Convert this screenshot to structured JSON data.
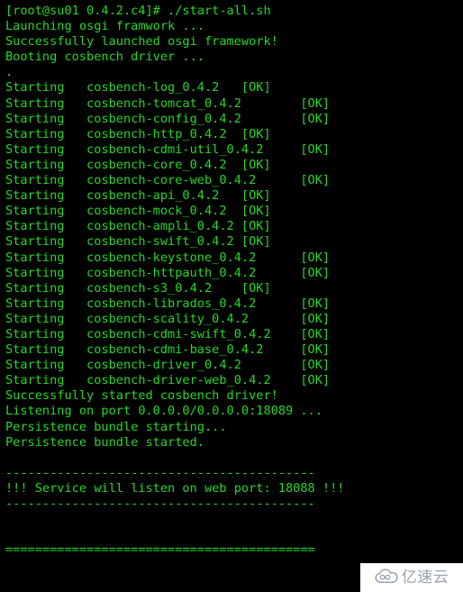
{
  "terminal": {
    "background_color": "#000000",
    "text_color": "#26d826",
    "prompt_line": "[root@su01 0.4.2.c4]# ./start-all.sh",
    "boot_messages": [
      "Launching osgi framwork ...",
      "Successfully launched osgi framework!",
      "Booting cosbench driver ...",
      "."
    ],
    "starting_label": "Starting",
    "ok_label": "[OK]",
    "modules": [
      "cosbench-log_0.4.2",
      "cosbench-tomcat_0.4.2",
      "cosbench-config_0.4.2",
      "cosbench-http_0.4.2",
      "cosbench-cdmi-util_0.4.2",
      "cosbench-core_0.4.2",
      "cosbench-core-web_0.4.2",
      "cosbench-api_0.4.2",
      "cosbench-mock_0.4.2",
      "cosbench-ampli_0.4.2",
      "cosbench-swift_0.4.2",
      "cosbench-keystone_0.4.2",
      "cosbench-httpauth_0.4.2",
      "cosbench-s3_0.4.2",
      "cosbench-librados_0.4.2",
      "cosbench-scality_0.4.2",
      "cosbench-cdmi-swift_0.4.2",
      "cosbench-cdmi-base_0.4.2",
      "cosbench-driver_0.4.2",
      "cosbench-driver-web_0.4.2"
    ],
    "post_messages": [
      "Successfully started cosbench driver!",
      "Listening on port 0.0.0.0/0.0.0.0:18089 ...",
      "Persistence bundle starting...",
      "Persistence bundle started."
    ],
    "separator_dash": "------------------------------------------",
    "service_banner": "!!! Service will listen on web port: 18088 !!!",
    "separator_equals": "==========================================",
    "web_port": "18088",
    "driver_port": "18089"
  },
  "watermark": {
    "text": "亿速云",
    "icon": "cloud-icon",
    "background_color": "#ffffff",
    "text_color": "#9aa3ad"
  }
}
